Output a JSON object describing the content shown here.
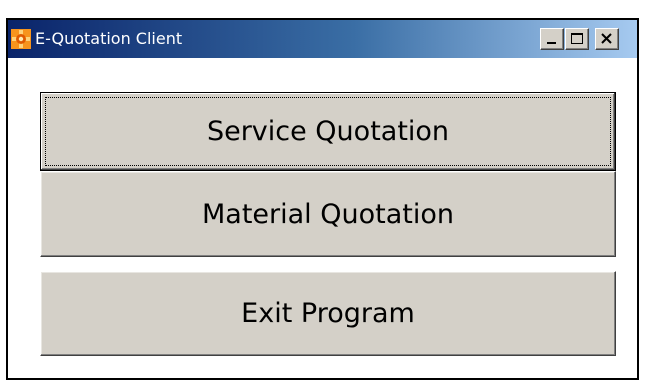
{
  "window": {
    "title": "E-Quotation Client",
    "app_icon": "gear-icon",
    "controls": {
      "minimize_icon": "minimize-icon",
      "maximize_icon": "maximize-icon",
      "close_icon": "close-icon"
    }
  },
  "buttons": {
    "service_quotation": "Service Quotation",
    "material_quotation": "Material Quotation",
    "exit_program": "Exit Program"
  },
  "colors": {
    "titlebar_start": "#0a246a",
    "titlebar_end": "#a6caf0",
    "button_face": "#d4d0c8",
    "icon_orange": "#f7941d"
  }
}
